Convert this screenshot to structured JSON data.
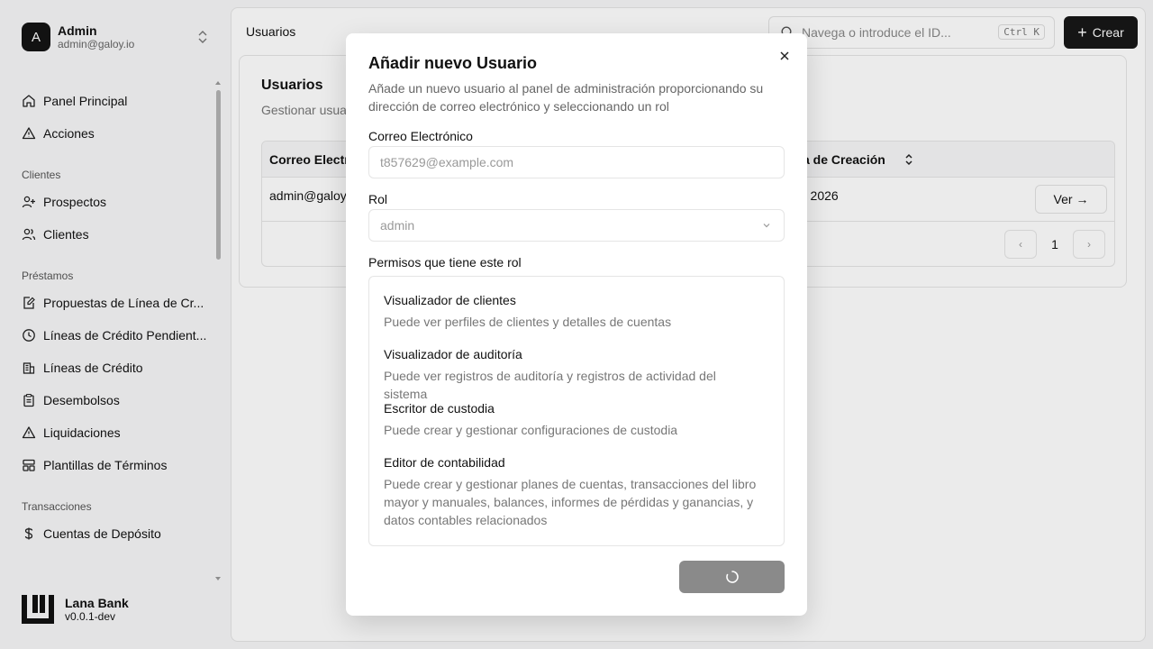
{
  "account": {
    "initial": "A",
    "name": "Admin",
    "email": "admin@galoy.io"
  },
  "nav": {
    "panel": "Panel Principal",
    "actions": "Acciones",
    "group_clients": "Clientes",
    "prospects": "Prospectos",
    "clients": "Clientes",
    "group_loans": "Préstamos",
    "proposals": "Propuestas de Línea de Cr...",
    "pending": "Líneas de Crédito Pendient...",
    "credit_lines": "Líneas de Crédito",
    "disbursals": "Desembolsos",
    "liquidations": "Liquidaciones",
    "templates": "Plantillas de Términos",
    "group_transactions": "Transacciones",
    "deposit_accounts": "Cuentas de Depósito"
  },
  "brand": {
    "name": "Lana Bank",
    "version": "v0.0.1-dev"
  },
  "topbar": {
    "title": "Usuarios",
    "search_placeholder": "Navega o introduce el ID...",
    "shortcut": "Ctrl K",
    "create_label": "Crear"
  },
  "card": {
    "title": "Usuarios",
    "subtitle": "Gestionar usuar",
    "col_email": "Correo Electró",
    "col_created": "a de Creación",
    "row_email": "admin@galoy.",
    "row_created": "r 2026",
    "view_label": "Ver →",
    "page": "1"
  },
  "modal": {
    "title": "Añadir nuevo Usuario",
    "description": "Añade un nuevo usuario al panel de administración proporcionando su dirección de correo electrónico y seleccionando un rol",
    "email_label": "Correo Electrónico",
    "email_placeholder": "t857629@example.com",
    "role_label": "Rol",
    "role_value": "admin",
    "permissions_label": "Permisos que tiene este rol",
    "permissions": [
      {
        "name": "Visualizador de clientes",
        "desc": "Puede ver perfiles de clientes y detalles de cuentas"
      },
      {
        "name": "Visualizador de auditoría",
        "desc": "Puede ver registros de auditoría y registros de actividad del sistema"
      },
      {
        "name": "Escritor de custodia",
        "desc": "Puede crear y gestionar configuraciones de custodia"
      },
      {
        "name": "Editor de contabilidad",
        "desc": "Puede crear y gestionar planes de cuentas, transacciones del libro mayor y manuales, balances, informes de pérdidas y ganancias, y datos contables relacionados"
      }
    ]
  },
  "colors": {
    "primary": "#171717",
    "submit_disabled": "#8a8a8a",
    "muted_text": "#777777"
  }
}
